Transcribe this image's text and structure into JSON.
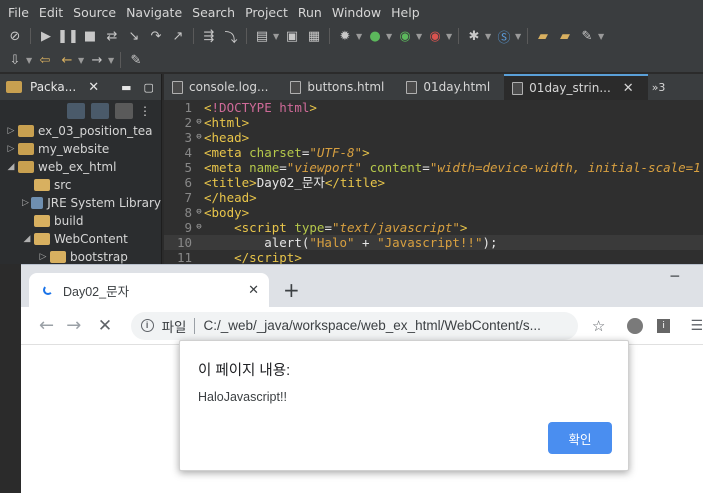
{
  "eclipse": {
    "menu": [
      "File",
      "Edit",
      "Source",
      "Navigate",
      "Search",
      "Project",
      "Run",
      "Window",
      "Help"
    ],
    "explorer": {
      "title": "Packa...",
      "items": [
        {
          "label": "ex_03_position_tea",
          "indent": 0,
          "arrow": "▷",
          "icon": "project"
        },
        {
          "label": "my_website",
          "indent": 0,
          "arrow": "▷",
          "icon": "project"
        },
        {
          "label": "web_ex_html",
          "indent": 0,
          "arrow": "◢",
          "icon": "project"
        },
        {
          "label": "src",
          "indent": 1,
          "arrow": "",
          "icon": "folder"
        },
        {
          "label": "JRE System Library",
          "indent": 1,
          "arrow": "▷",
          "icon": "library"
        },
        {
          "label": "build",
          "indent": 1,
          "arrow": "",
          "icon": "folder"
        },
        {
          "label": "WebContent",
          "indent": 1,
          "arrow": "◢",
          "icon": "folder"
        },
        {
          "label": "bootstrap",
          "indent": 2,
          "arrow": "▷",
          "icon": "folder"
        }
      ]
    },
    "editor_tabs": [
      {
        "label": "console.log...",
        "active": false
      },
      {
        "label": "buttons.html",
        "active": false
      },
      {
        "label": "01day.html",
        "active": false
      },
      {
        "label": "01day_strin...",
        "active": true
      }
    ],
    "more_tabs": "»3",
    "code_lines": [
      {
        "n": "1",
        "fold": "",
        "html": "<span class='tag'>&lt;</span><span class='doctype'>!DOCTYPE html</span><span class='tag'>&gt;</span>"
      },
      {
        "n": "2",
        "fold": "⊖",
        "html": "<span class='tag'>&lt;html&gt;</span>"
      },
      {
        "n": "3",
        "fold": "⊖",
        "html": "<span class='tag'>&lt;head&gt;</span>"
      },
      {
        "n": "4",
        "fold": "",
        "html": "<span class='tag'>&lt;meta </span><span class='attr'>charset</span><span class='txt'>=</span><span class='val'>\"UTF-8\"</span><span class='tag'>&gt;</span>"
      },
      {
        "n": "5",
        "fold": "",
        "html": "<span class='tag'>&lt;meta </span><span class='attr'>name</span><span class='txt'>=</span><span class='val'>\"viewport\"</span> <span class='attr'>content</span><span class='txt'>=</span><span class='val'>\"width=device-width, initial-scale=1.0\"</span><span class='tag'>&gt;</span>"
      },
      {
        "n": "6",
        "fold": "",
        "html": "<span class='tag'>&lt;title&gt;</span><span class='txt'>Day02_문자</span><span class='tag'>&lt;/title&gt;</span>"
      },
      {
        "n": "7",
        "fold": "",
        "html": "<span class='tag'>&lt;/head&gt;</span>"
      },
      {
        "n": "8",
        "fold": "⊖",
        "html": "<span class='tag'>&lt;body&gt;</span>"
      },
      {
        "n": "9",
        "fold": "⊖",
        "html": "    <span class='tag'>&lt;script </span><span class='attr'>type</span><span class='txt'>=</span><span class='val'>\"text/javascript\"</span><span class='tag'>&gt;</span>"
      },
      {
        "n": "10",
        "fold": "",
        "html": "        <span class='txt'>alert(</span><span class='str'>\"Halo\"</span><span class='txt'> + </span><span class='str'>\"Javascript!!\"</span><span class='txt'>);</span>",
        "highlight": true
      },
      {
        "n": "11",
        "fold": "",
        "html": "    <span class='tag'>&lt;/script&gt;</span>"
      }
    ]
  },
  "browser": {
    "tab_title": "Day02_문자",
    "tab_close": "✕",
    "new_tab": "+",
    "minimize": "─",
    "scheme_label": "파일",
    "url": "C:/_web/_java/workspace/web_ex_html/WebContent/s...",
    "dialog": {
      "title": "이 페이지 내용:",
      "message": "HaloJavascript!!",
      "ok_label": "확인"
    }
  },
  "colors": {
    "eclipse_bg": "#2b2b2b",
    "tag": "#e8c54a",
    "dialog_button": "#4a8ef0",
    "chrome_tabstrip": "#dee1e6"
  }
}
